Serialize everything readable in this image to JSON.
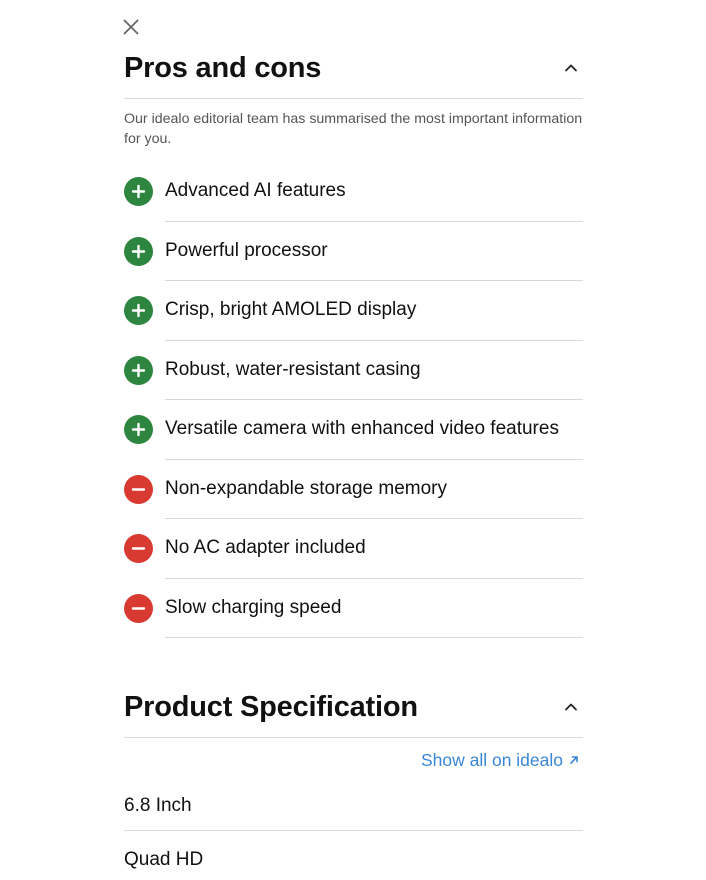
{
  "pros_cons": {
    "title": "Pros and cons",
    "intro": "Our idealo editorial team has summarised the most important information for you.",
    "items": [
      {
        "type": "pro",
        "text": "Advanced AI features"
      },
      {
        "type": "pro",
        "text": "Powerful processor"
      },
      {
        "type": "pro",
        "text": "Crisp, bright AMOLED display"
      },
      {
        "type": "pro",
        "text": "Robust, water-resistant casing"
      },
      {
        "type": "pro",
        "text": "Versatile camera with enhanced video features"
      },
      {
        "type": "con",
        "text": "Non-expandable storage memory"
      },
      {
        "type": "con",
        "text": "No AC adapter included"
      },
      {
        "type": "con",
        "text": "Slow charging speed"
      }
    ]
  },
  "spec": {
    "title": "Product Specification",
    "link_label": "Show all on idealo",
    "rows": [
      "6.8 Inch",
      "Quad HD"
    ]
  },
  "colors": {
    "pro": "#2e8540",
    "con": "#d83a31",
    "link": "#3a86d6"
  },
  "icons": {
    "close": "close-icon",
    "collapse": "chevron-up-icon",
    "pro": "plus-icon",
    "con": "minus-icon",
    "external": "arrow-up-right-icon"
  }
}
